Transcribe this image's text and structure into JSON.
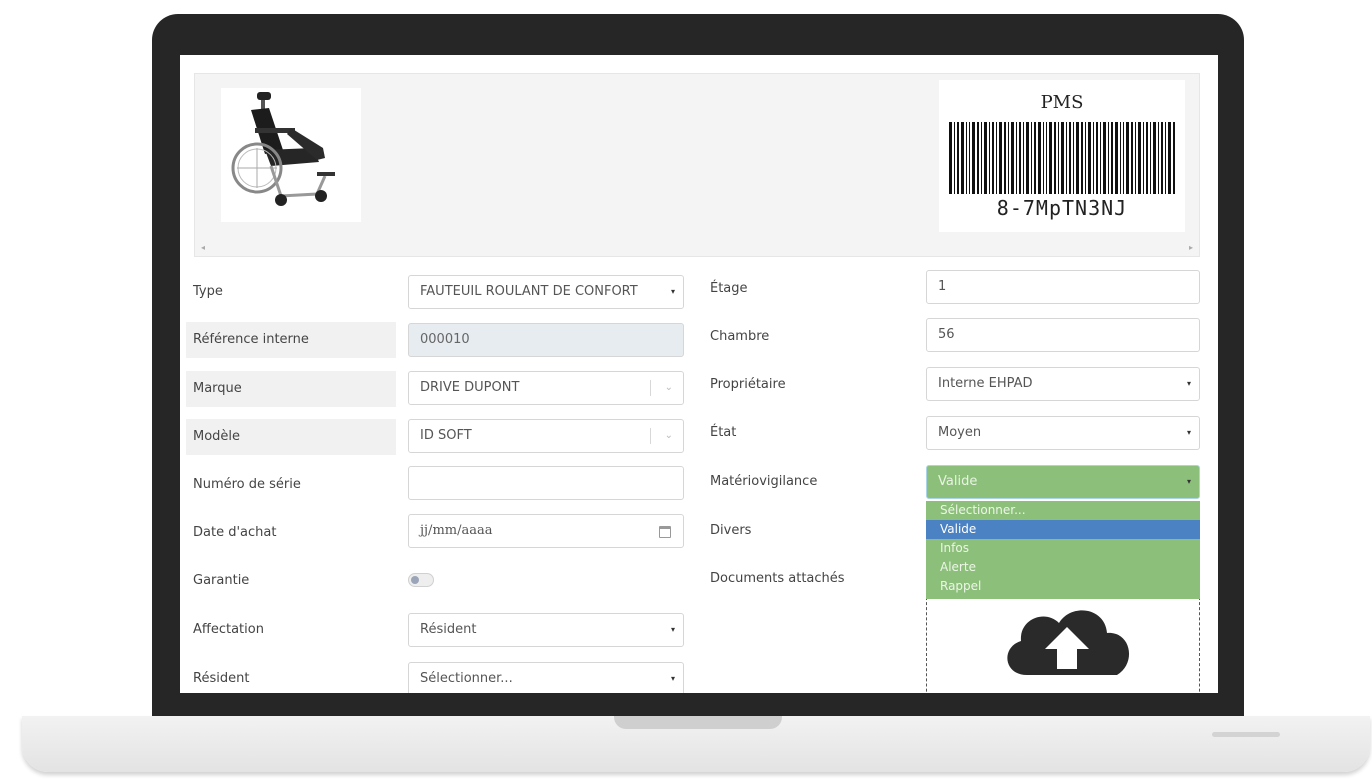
{
  "header": {
    "barcode_title": "PMS",
    "barcode_value": "8-7MpTN3NJ",
    "scroll_left": "◂",
    "scroll_right": "▸"
  },
  "form_left": {
    "type_label": "Type",
    "type_value": "FAUTEUIL ROULANT DE CONFORT",
    "ref_label": "Référence interne",
    "ref_value": "000010",
    "brand_label": "Marque",
    "brand_value": "DRIVE DUPONT",
    "model_label": "Modèle",
    "model_value": "ID SOFT",
    "serial_label": "Numéro de série",
    "serial_value": "",
    "purchase_label": "Date d'achat",
    "purchase_placeholder": "jj/mm/aaaa",
    "warranty_label": "Garantie",
    "assignment_label": "Affectation",
    "assignment_value": "Résident",
    "resident_label": "Résident",
    "resident_value": "Sélectionner..."
  },
  "form_right": {
    "floor_label": "Étage",
    "floor_value": "1",
    "room_label": "Chambre",
    "room_value": "56",
    "owner_label": "Propriétaire",
    "owner_value": "Interne EHPAD",
    "state_label": "État",
    "state_value": "Moyen",
    "vigilance_label": "Matériovigilance",
    "vigilance_value": "Valide",
    "misc_label": "Divers",
    "docs_label": "Documents attachés"
  },
  "vigilance_options": [
    "Sélectionner...",
    "Valide",
    "Infos",
    "Alerte",
    "Rappel"
  ],
  "vigilance_highlighted": "Valide",
  "icons": {
    "caret": "▾",
    "combo_caret": "⌄",
    "upload": "cloud-upload-icon",
    "calendar": "calendar-icon"
  },
  "colors": {
    "valid_green": "#8cc07a",
    "highlight_blue": "#4a82c4",
    "readonly_bg": "#e6ecf0"
  }
}
